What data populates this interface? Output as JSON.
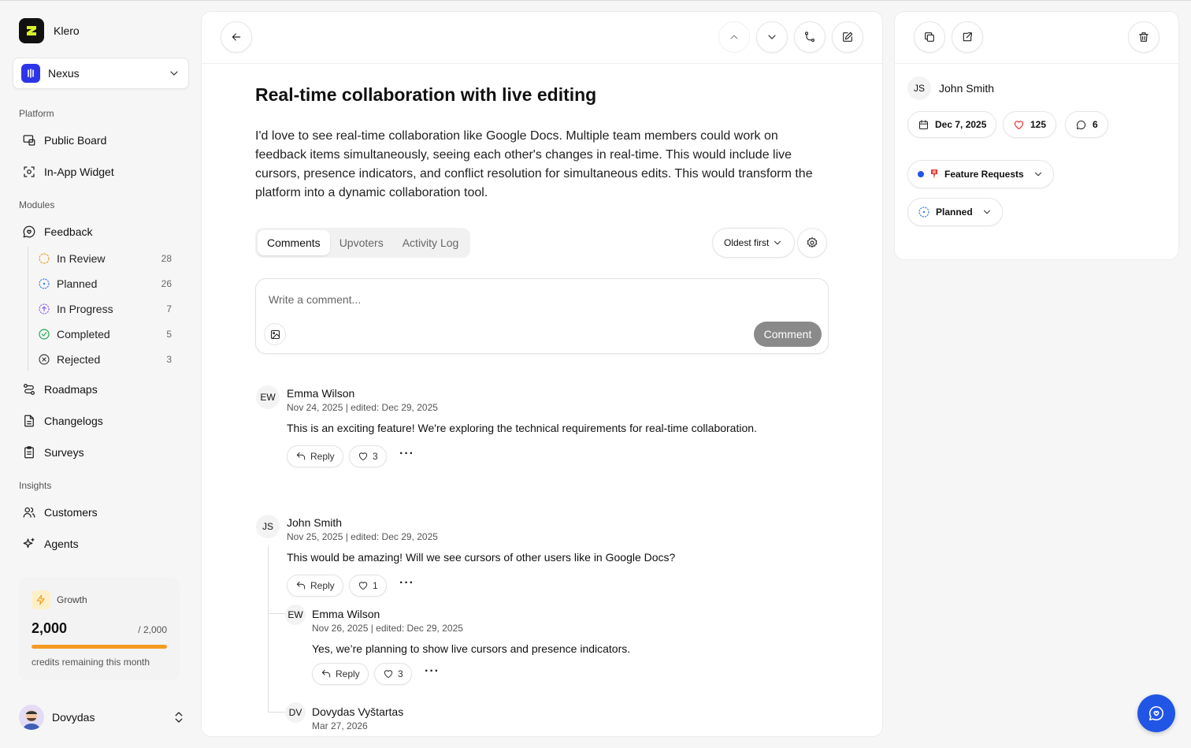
{
  "app": {
    "name": "Klero"
  },
  "workspace": {
    "name": "Nexus"
  },
  "sidebar": {
    "platform_label": "Platform",
    "public_board": "Public Board",
    "in_app_widget": "In-App Widget",
    "modules_label": "Modules",
    "feedback": "Feedback",
    "statuses": [
      {
        "label": "In Review",
        "count": "28",
        "color": "#f59b22"
      },
      {
        "label": "Planned",
        "count": "26",
        "color": "#2f7be8"
      },
      {
        "label": "In Progress",
        "count": "7",
        "color": "#8b5cf6"
      },
      {
        "label": "Completed",
        "count": "5",
        "color": "#16a34a"
      },
      {
        "label": "Rejected",
        "count": "3",
        "color": "#333333"
      }
    ],
    "roadmaps": "Roadmaps",
    "changelogs": "Changelogs",
    "surveys": "Surveys",
    "insights_label": "Insights",
    "customers": "Customers",
    "agents": "Agents"
  },
  "plan": {
    "name": "Growth",
    "credits": "2,000",
    "total": "/ 2,000",
    "note": "credits remaining this month",
    "remaining_fraction": 1.0,
    "bar_color": "#f59b22"
  },
  "user": {
    "name": "Dovydas"
  },
  "post": {
    "title": "Real-time collaboration with live editing",
    "description": "I'd love to see real-time collaboration like Google Docs. Multiple team members could work on feedback items simultaneously, seeing each other's changes in real-time. This would include live cursors, presence indicators, and conflict resolution for simultaneous edits. This would transform the platform into a dynamic collaboration tool."
  },
  "tabs": [
    "Comments",
    "Upvoters",
    "Activity Log"
  ],
  "sort": {
    "label": "Oldest first"
  },
  "composer": {
    "placeholder": "Write a comment...",
    "submit": "Comment"
  },
  "comments": [
    {
      "initials": "EW",
      "author": "Emma Wilson",
      "meta": "Nov 24, 2025 | edited: Dec 29, 2025",
      "text": "This is an exciting feature! We're exploring the technical requirements for real-time collaboration.",
      "reply": "Reply",
      "likes": "3"
    },
    {
      "initials": "JS",
      "author": "John Smith",
      "meta": "Nov 25, 2025 | edited: Dec 29, 2025",
      "text": "This would be amazing! Will we see cursors of other users like in Google Docs?",
      "reply": "Reply",
      "likes": "1"
    },
    {
      "initials": "EW",
      "author": "Emma Wilson",
      "meta": "Nov 26, 2025 | edited: Dec 29, 2025",
      "text": "Yes, we’re planning to show live cursors and presence indicators.",
      "reply": "Reply",
      "likes": "3"
    },
    {
      "initials": "DV",
      "author": "Dovydas Vyštartas",
      "meta": "Mar 27, 2026"
    }
  ],
  "details": {
    "author_initials": "JS",
    "author": "John Smith",
    "date": "Dec 7, 2025",
    "votes": "125",
    "comments": "6",
    "board": "Feature Requests",
    "board_color": "#2155e6",
    "status": "Planned",
    "status_color": "#2f7be8"
  },
  "icons": {
    "accent": "#2155e6"
  }
}
